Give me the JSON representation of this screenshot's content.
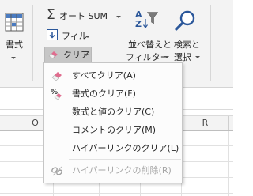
{
  "ribbon": {
    "format_label": "書式",
    "autosum_label": "オート SUM",
    "fill_label": "フィル",
    "clear_label": "クリア",
    "sort_filter_line1": "並べ替えと",
    "sort_filter_line2": "フィルター",
    "find_select_line1": "検索と",
    "find_select_line2": "選択"
  },
  "sheet": {
    "columns": [
      "O",
      "R"
    ]
  },
  "menu": {
    "items": [
      {
        "label": "すべてクリア(A)",
        "icon": "eraser-icon",
        "enabled": true
      },
      {
        "label": "書式のクリア(F)",
        "icon": "clear-formats-icon",
        "enabled": true
      },
      {
        "label": "数式と値のクリア(C)",
        "icon": "",
        "enabled": true
      },
      {
        "label": "コメントのクリア(M)",
        "icon": "",
        "enabled": true
      },
      {
        "label": "ハイパーリンクのクリア(L)",
        "icon": "",
        "enabled": true
      },
      {
        "label": "ハイパーリンクの削除(R)",
        "icon": "unlink-icon",
        "enabled": false
      }
    ]
  },
  "colors": {
    "ribbon_bg": "#f3f3f3",
    "pressed_bg": "#c6c6c6",
    "icon_blue": "#2b579a",
    "eraser_pink": "#e06c8e"
  }
}
